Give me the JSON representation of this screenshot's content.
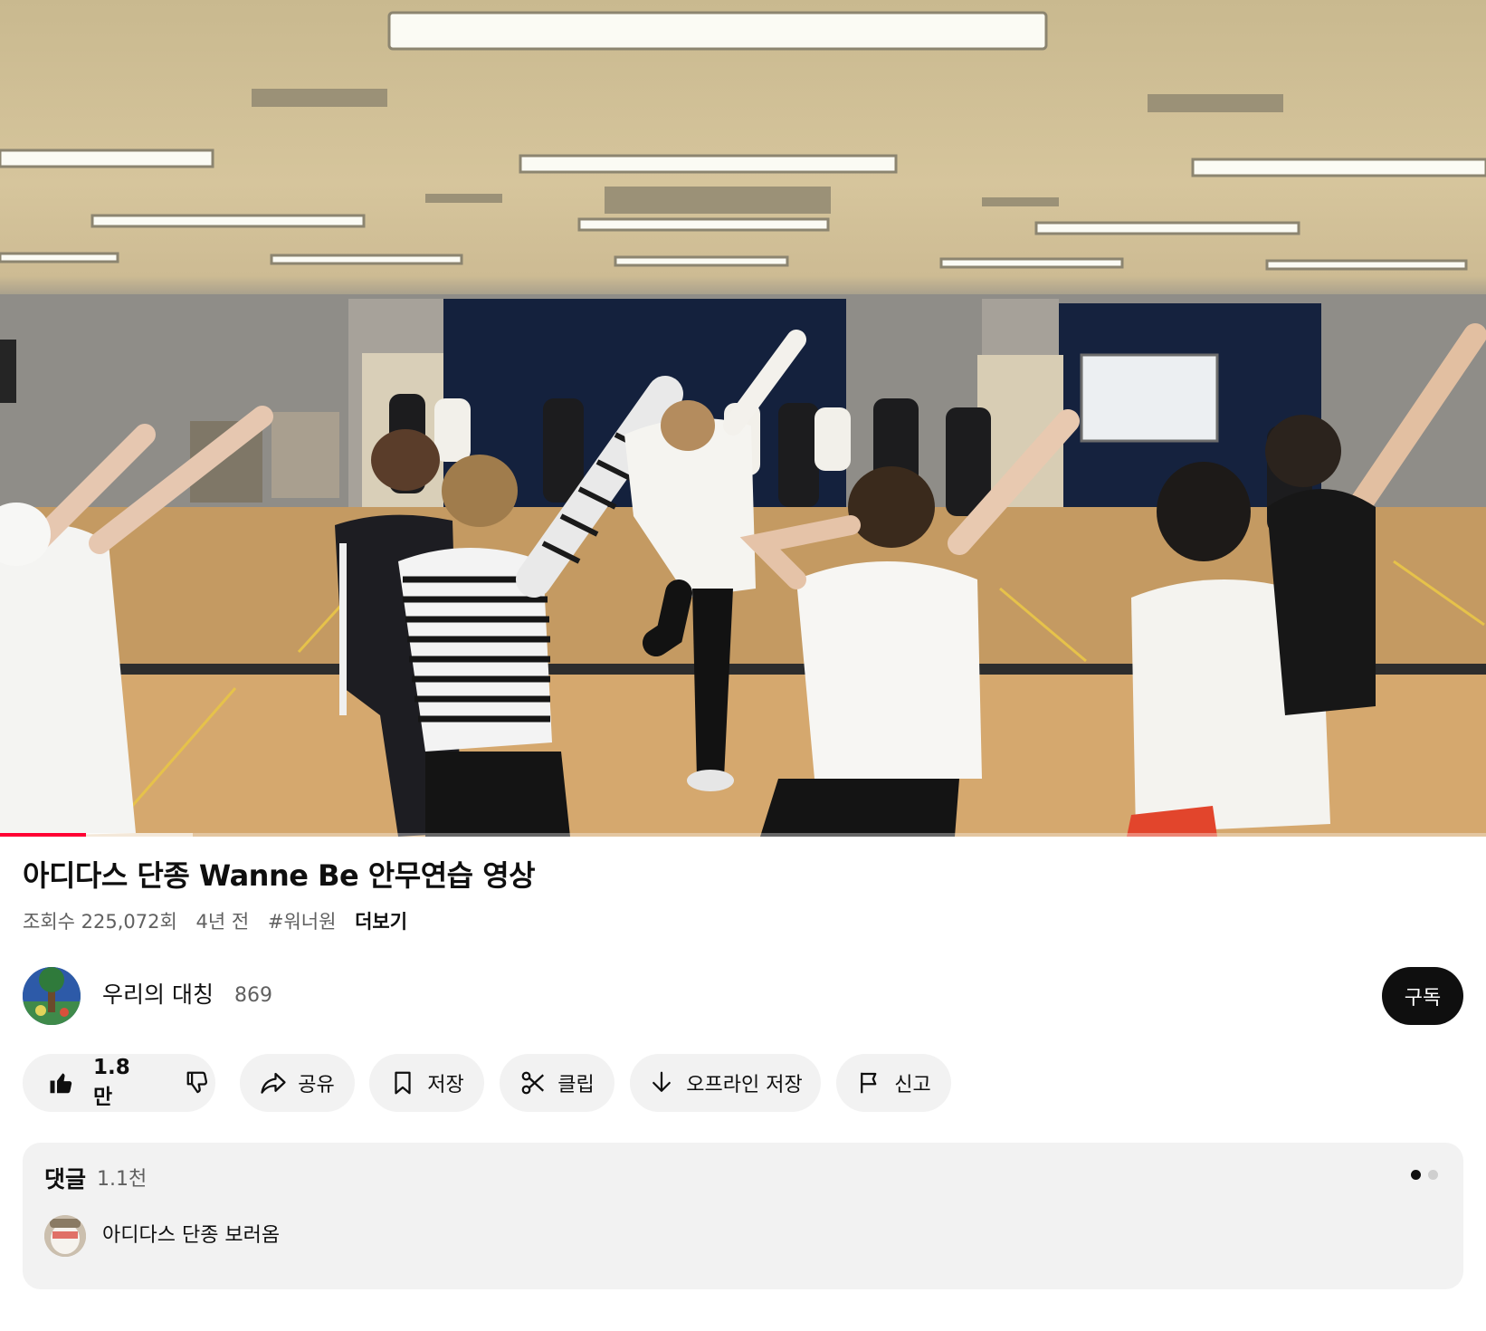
{
  "video": {
    "thumbnail_icon": "dance-practice-video-frame",
    "progress_played": 0.058,
    "progress_buffered": 0.13
  },
  "title": "아디다스 단종 Wanne Be 안무연습 영상",
  "meta": {
    "views": "조회수 225,072회",
    "age": "4년 전",
    "hashtag": "#워너원",
    "more": "더보기"
  },
  "channel": {
    "name": "우리의 대칭",
    "subscribers": "869",
    "subscribe_label": "구독"
  },
  "actions": {
    "like_count": "1.8만",
    "share": "공유",
    "save": "저장",
    "clip": "클립",
    "download": "오프라인 저장",
    "report": "신고"
  },
  "comments": {
    "title": "댓글",
    "count": "1.1천",
    "top_comment": "아디다스 단종 보러옴",
    "pager_pages": 2,
    "pager_active": 1
  },
  "colors": {
    "progress": "#ff0033",
    "chip_bg": "#f2f2f2",
    "subscribe_bg": "#0f0f0f"
  }
}
